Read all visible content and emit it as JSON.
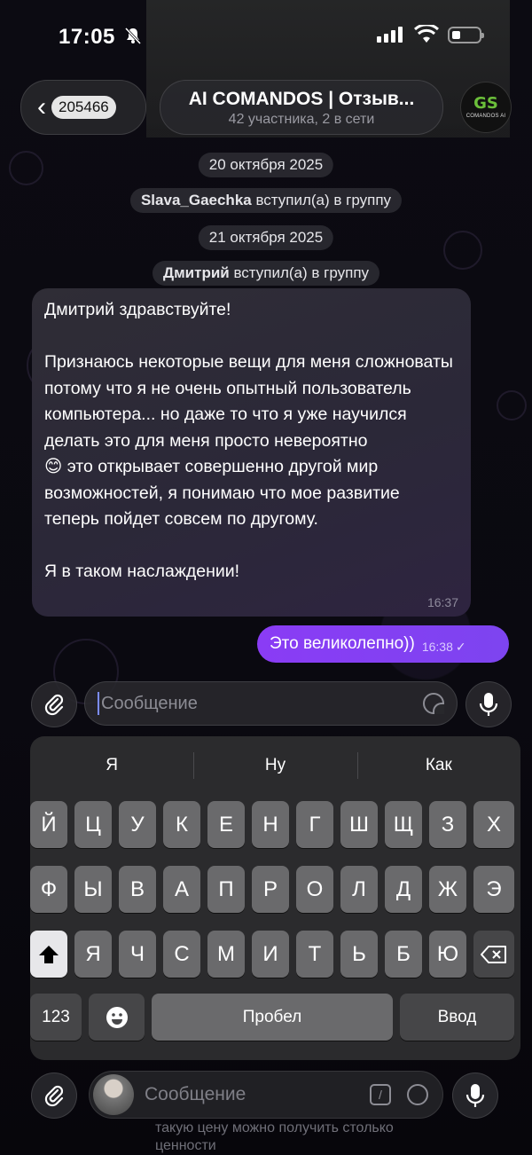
{
  "status_bar": {
    "time": "17:05"
  },
  "header": {
    "back_badge": "205466",
    "title": "AI COMANDOS | Отзыв...",
    "subtitle": "42 участника, 2 в сети",
    "logo_mark": "GS",
    "logo_text": "COMANDOS AI"
  },
  "service": {
    "date1": "20 октября 2025",
    "join1_name": "Slava_Gaechka",
    "join1_text": " вступил(а) в группу",
    "date2": "21 октября 2025",
    "join2_name": "Дмитрий",
    "join2_text": " вступил(а) в группу"
  },
  "messages": {
    "incoming_text": "Дмитрий здравствуйте!\n\nПризнаюсь некоторые вещи для меня сложноваты потому что я не очень опытный пользователь компьютера... но даже то что я уже научился делать это для меня просто невероятно\n😊 это открывает совершенно другой мир возможностей, я понимаю что мое развитие теперь пойдет совсем по другому.\n\nЯ в таком наслаждении!",
    "incoming_time": "16:37",
    "outgoing_text": "Это великолепно))",
    "outgoing_time": "16:38"
  },
  "composer": {
    "placeholder": "Сообщение"
  },
  "keyboard": {
    "suggestions": [
      "Я",
      "Ну",
      "Как"
    ],
    "row1": [
      "Й",
      "Ц",
      "У",
      "К",
      "Е",
      "Н",
      "Г",
      "Ш",
      "Щ",
      "З",
      "Х"
    ],
    "row2": [
      "Ф",
      "Ы",
      "В",
      "А",
      "П",
      "Р",
      "О",
      "Л",
      "Д",
      "Ж",
      "Э"
    ],
    "row3": [
      "Я",
      "Ч",
      "С",
      "М",
      "И",
      "Т",
      "Ь",
      "Б",
      "Ю"
    ],
    "numbers_key": "123",
    "space_key": "Пробел",
    "enter_key": "Ввод"
  },
  "background_composer": {
    "placeholder": "Сообщение",
    "text_line1": "такую цену можно получить столько",
    "text_line2": "ценности"
  }
}
